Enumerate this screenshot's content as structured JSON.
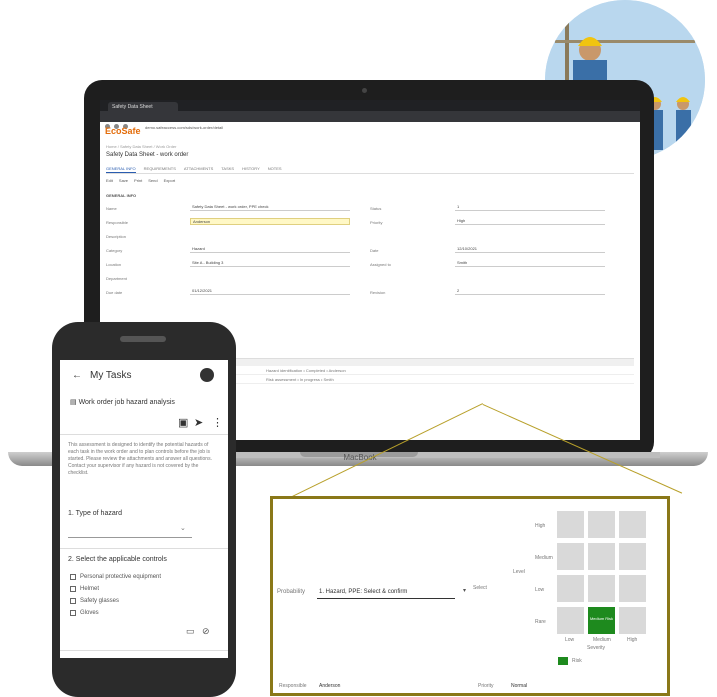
{
  "laptop": {
    "brand": "MacBook",
    "browser_tab": "Safety Data Sheet",
    "url": "demo.safeaccess.com/sds/work-order/detail",
    "app_logo": "EcoSafe",
    "breadcrumb": "Home / Safety Data Sheet / Work Order",
    "page_title": "Safety Data Sheet - work order",
    "tabs": [
      "GENERAL INFO",
      "REQUIREMENTS",
      "ATTACHMENTS",
      "TASKS",
      "HISTORY",
      "NOTES"
    ],
    "toolbar": [
      "Edit",
      "Save",
      "Print",
      "Send",
      "Export"
    ],
    "section": "GENERAL INFO",
    "fields": [
      {
        "label": "Name",
        "value": "Safety Data Sheet - work order, PPE check"
      },
      {
        "label": "Responsible",
        "value": "Anderson"
      },
      {
        "label": "Description",
        "value": ""
      },
      {
        "label": "Category",
        "value": "Hazard"
      },
      {
        "label": "Location",
        "value": "Site A - Building 3"
      },
      {
        "label": "Department",
        "value": "Construction"
      },
      {
        "label": "Due date",
        "value": "01/12/2021"
      }
    ],
    "right_fields": [
      {
        "label": "Status",
        "value": "1"
      },
      {
        "label": "Priority",
        "value": "High"
      },
      {
        "label": "Date",
        "value": "12/10/2021"
      },
      {
        "label": "Assigned to",
        "value": "Smith"
      },
      {
        "label": "Revision",
        "value": "2"
      }
    ],
    "grid_rows": [
      "Hazard identification  •  Completed  •  Anderson",
      "Risk assessment  •  In progress  •  Smith"
    ]
  },
  "phone": {
    "back_title": "My Tasks",
    "doc_title": "Work order job hazard analysis",
    "body_text": "This assessment is designed to identify the potential hazards of each task in the work order and to plan controls before the job is started. Please review the attachments and answer all questions. Contact your supervisor if any hazard is not covered by the checklist.",
    "question1": "1. Type of hazard",
    "question2": "2. Select the applicable controls",
    "options": [
      "Personal protective equipment",
      "Helmet",
      "Safety glasses",
      "Gloves"
    ]
  },
  "zoom": {
    "left_label": "Probability",
    "input_value": "1. Hazard, PPE: Select & confirm",
    "level_label": "Level",
    "button_label": "Select",
    "row_labels": [
      "High",
      "Medium",
      "Low",
      "Rare"
    ],
    "col_labels": [
      "Low",
      "Medium",
      "High"
    ],
    "cell_text": "Medium Risk",
    "axis_label": "Severity",
    "legend": "Risk",
    "bottom_left": "Responsible",
    "bottom_value": "Anderson",
    "bottom_right_label": "Priority",
    "bottom_right_value": "Normal"
  },
  "colors": {
    "accent": "#1e8a1e",
    "brand": "#e36c0a",
    "link": "#2a5db0"
  }
}
